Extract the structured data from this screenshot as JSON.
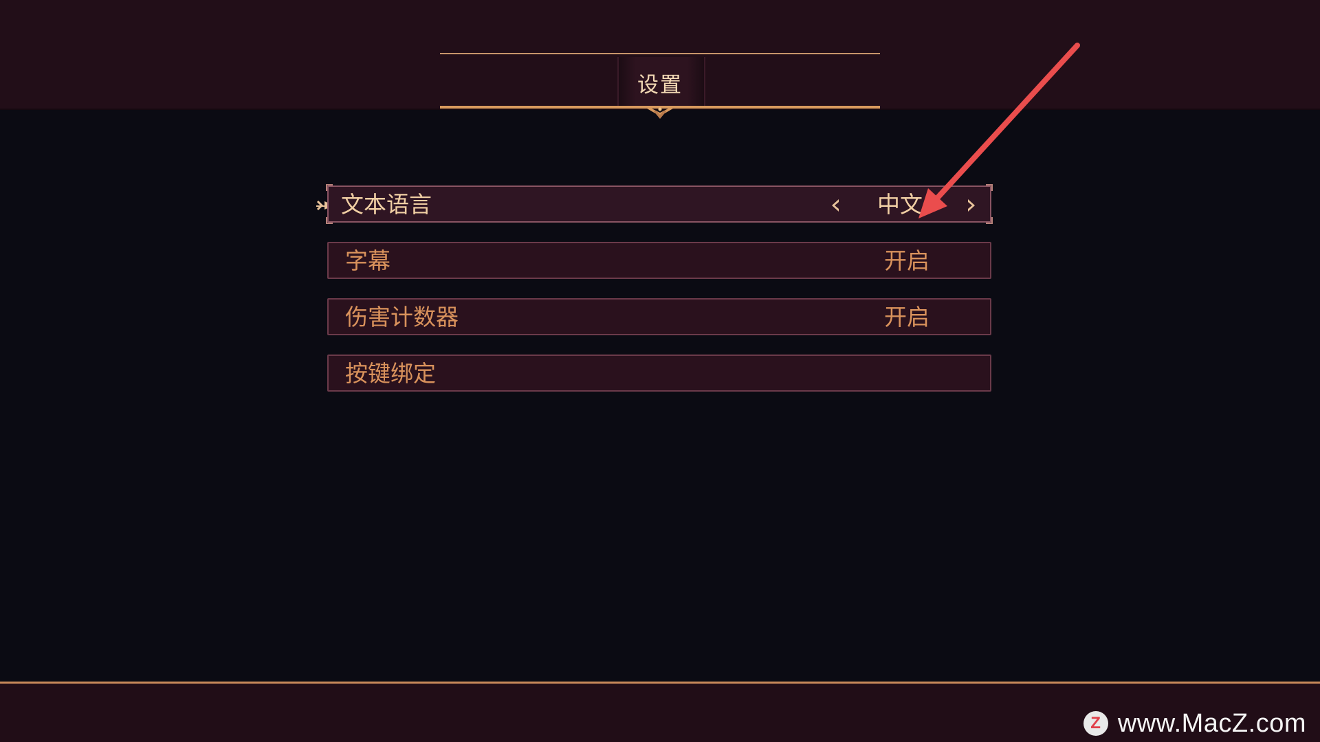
{
  "page": {
    "title": "设置"
  },
  "settings": {
    "rows": [
      {
        "label": "文本语言",
        "value": "中文"
      },
      {
        "label": "字幕",
        "value": "开启"
      },
      {
        "label": "伤害计数器",
        "value": "开启"
      },
      {
        "label": "按键绑定",
        "value": ""
      }
    ]
  },
  "icons": {
    "left_arrow": "chevron-left-icon",
    "right_arrow": "chevron-right-icon",
    "cursor": "pointer-hand-icon"
  },
  "watermark": {
    "logo_letter": "Z",
    "text": "www.MacZ.com"
  },
  "colors": {
    "header_bg": "#220e18",
    "body_bg": "#0b0b13",
    "accent_gold": "#d99a5e",
    "label_text": "#d9925c",
    "selected_text": "#f1cfa4",
    "annotation_arrow": "#ea4d4d"
  }
}
